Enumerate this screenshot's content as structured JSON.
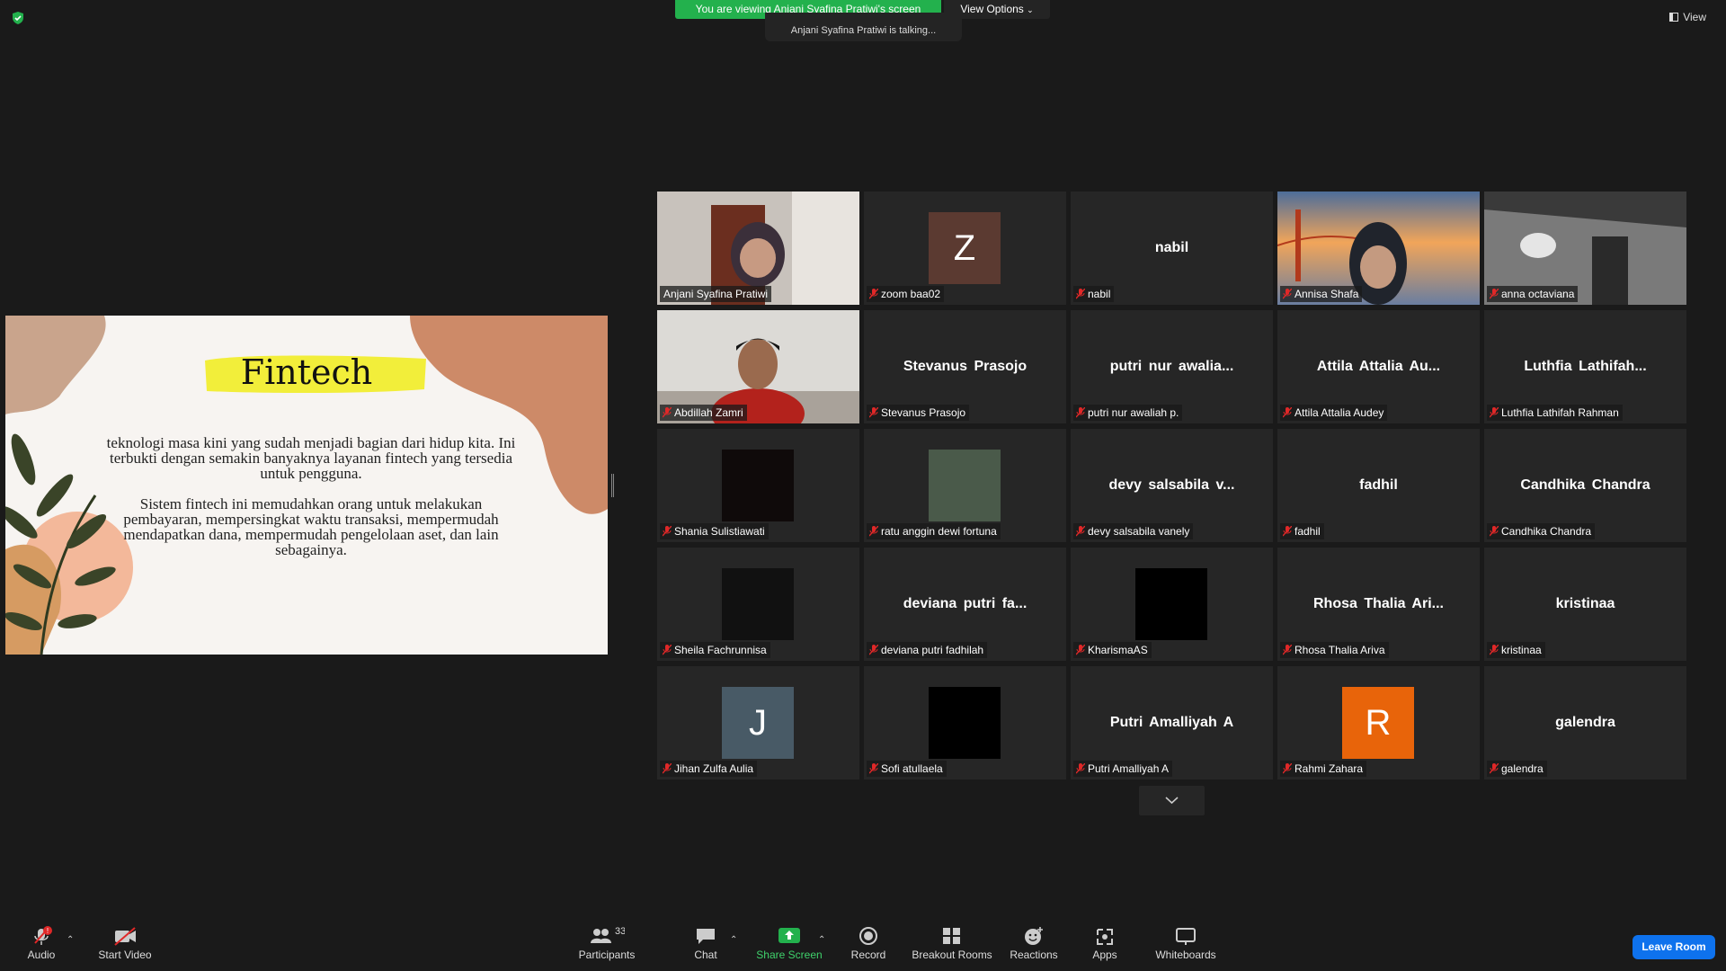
{
  "header": {
    "viewing_banner": "You are viewing Anjani Syafina Pratiwi's screen",
    "talking_text": "Anjani Syafina Pratiwi is talking...",
    "view_options": "View Options",
    "view_label": "View"
  },
  "slide": {
    "title": "Fintech",
    "paragraph1": "teknologi masa kini yang sudah menjadi bagian dari hidup kita. Ini terbukti dengan semakin banyaknya layanan fintech yang tersedia untuk pengguna.",
    "paragraph2": "Sistem fintech ini memudahkan orang untuk melakukan pembayaran, mempersingkat waktu transaksi, mempermudah mendapatkan dana, mempermudah pengelolaan aset, dan lain sebagainya."
  },
  "participants": [
    {
      "name": "Anjani Syafina Pratiwi",
      "kind": "video",
      "active": true
    },
    {
      "name": "zoom baa02",
      "kind": "avatar",
      "initial": "Z",
      "color": "#5b3a31"
    },
    {
      "name": "nabil",
      "kind": "text",
      "big": "nabil"
    },
    {
      "name": "Annisa Shafa",
      "kind": "video"
    },
    {
      "name": "anna octaviana",
      "kind": "video"
    },
    {
      "name": "Abdillah Zamri",
      "kind": "video"
    },
    {
      "name": "Stevanus Prasojo",
      "kind": "text",
      "big": "Stevanus Prasojo"
    },
    {
      "name": "putri nur awaliah p.",
      "kind": "text",
      "big": "putri nur awalia..."
    },
    {
      "name": "Attila Attalia Audey",
      "kind": "text",
      "big": "Attila Attalia Au..."
    },
    {
      "name": "Luthfia Lathifah Rahman",
      "kind": "text",
      "big": "Luthfia Lathifah..."
    },
    {
      "name": "Shania Sulistiawati",
      "kind": "picture",
      "color": "#0f0a0a"
    },
    {
      "name": "ratu anggin dewi fortuna",
      "kind": "picture",
      "color": "#4a5a4a"
    },
    {
      "name": "devy salsabila vanely",
      "kind": "text",
      "big": "devy salsabila v..."
    },
    {
      "name": "fadhil",
      "kind": "text",
      "big": "fadhil"
    },
    {
      "name": "Candhika Chandra",
      "kind": "text",
      "big": "Candhika Chandra"
    },
    {
      "name": "Sheila Fachrunnisa",
      "kind": "picture",
      "color": "#111"
    },
    {
      "name": "deviana putri fadhilah",
      "kind": "text",
      "big": "deviana putri fa..."
    },
    {
      "name": "KharismaAS",
      "kind": "picture",
      "color": "#000"
    },
    {
      "name": "Rhosa Thalia Ariva",
      "kind": "text",
      "big": "Rhosa Thalia Ari..."
    },
    {
      "name": "kristinaa",
      "kind": "text",
      "big": "kristinaa"
    },
    {
      "name": "Jihan Zulfa Aulia",
      "kind": "avatar",
      "initial": "J",
      "color": "#485a66"
    },
    {
      "name": "Sofi atullaela",
      "kind": "picture",
      "color": "#000"
    },
    {
      "name": "Putri Amalliyah A",
      "kind": "text",
      "big": "Putri Amalliyah A"
    },
    {
      "name": "Rahmi Zahara",
      "kind": "avatar",
      "initial": "R",
      "color": "#e8640a"
    },
    {
      "name": "galendra",
      "kind": "text",
      "big": "galendra"
    }
  ],
  "toolbar": {
    "audio": "Audio",
    "audio_badge": "!",
    "video": "Start Video",
    "participants": "Participants",
    "participants_count": "33",
    "chat": "Chat",
    "share": "Share Screen",
    "record": "Record",
    "breakout": "Breakout Rooms",
    "reactions": "Reactions",
    "apps": "Apps",
    "whiteboards": "Whiteboards",
    "leave": "Leave Room"
  },
  "colors": {
    "accent_green": "#23b14d",
    "active_border": "#d8f24b",
    "leave_blue": "#0e72ed",
    "mute_red": "#e02828"
  }
}
